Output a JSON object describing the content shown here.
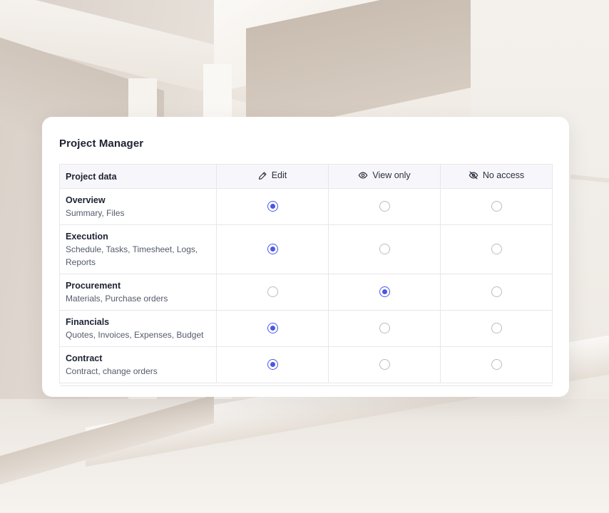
{
  "card": {
    "title": "Project Manager"
  },
  "table": {
    "columns": {
      "name": "Project data",
      "edit": {
        "label": "Edit",
        "icon": "pencil-icon"
      },
      "view": {
        "label": "View only",
        "icon": "eye-icon"
      },
      "none": {
        "label": "No access",
        "icon": "eye-off-icon"
      }
    },
    "rows": [
      {
        "title": "Overview",
        "subtitle": "Summary, Files",
        "selected": "edit"
      },
      {
        "title": "Execution",
        "subtitle": "Schedule, Tasks, Timesheet, Logs, Reports",
        "selected": "edit"
      },
      {
        "title": "Procurement",
        "subtitle": "Materials, Purchase orders",
        "selected": "view"
      },
      {
        "title": "Financials",
        "subtitle": "Quotes, Invoices, Expenses, Budget",
        "selected": "edit"
      },
      {
        "title": "Contract",
        "subtitle": "Contract, change orders",
        "selected": "edit"
      }
    ]
  },
  "colors": {
    "accent": "#4a57e6",
    "radio_border": "#b9bcc6",
    "header_bg": "#f7f7fb",
    "grid": "#e6e7ec"
  }
}
